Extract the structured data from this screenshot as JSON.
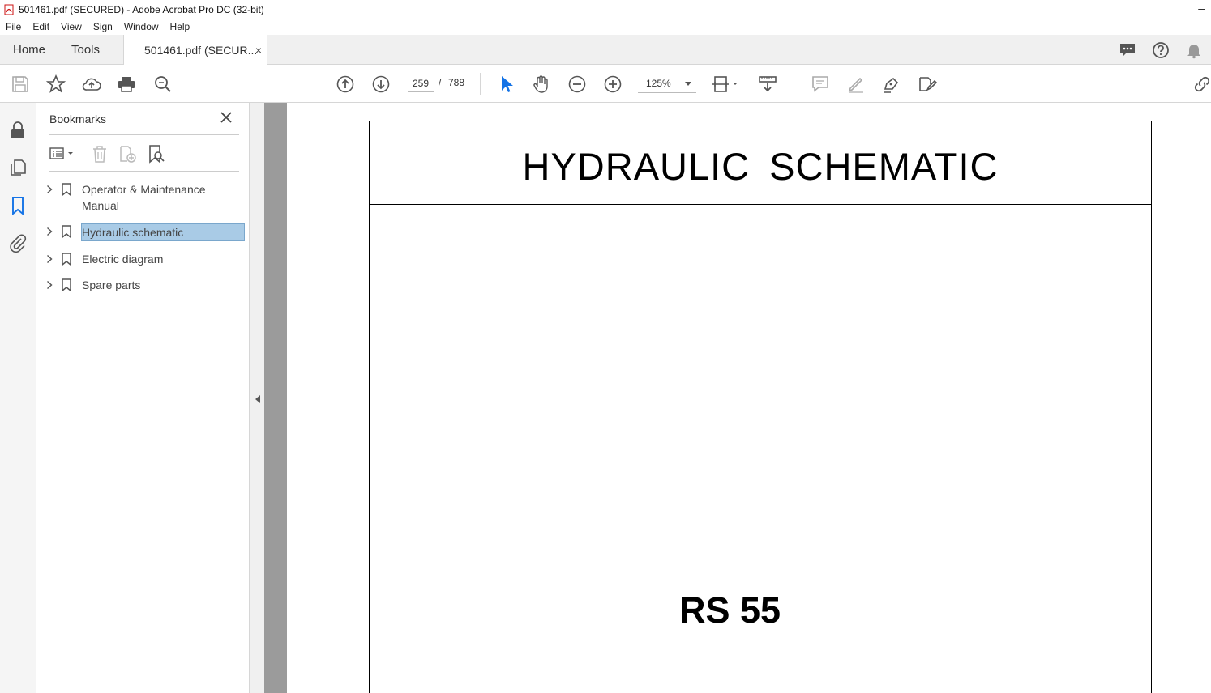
{
  "window": {
    "title": "501461.pdf (SECURED) - Adobe Acrobat Pro DC (32-bit)",
    "minimize_glyph": "–"
  },
  "menu": [
    "File",
    "Edit",
    "View",
    "Sign",
    "Window",
    "Help"
  ],
  "tabs": {
    "home": "Home",
    "tools": "Tools",
    "document": "501461.pdf (SECUR...",
    "close_glyph": "×"
  },
  "toolbar": {
    "page_current": "259",
    "page_sep": "/",
    "page_total": "788",
    "zoom": "125%"
  },
  "panel": {
    "title": "Bookmarks",
    "bookmarks": [
      {
        "label": "Operator & Maintenance Manual",
        "selected": false
      },
      {
        "label": "Hydraulic schematic",
        "selected": true
      },
      {
        "label": "Electric diagram",
        "selected": false
      },
      {
        "label": "Spare parts",
        "selected": false
      }
    ]
  },
  "document": {
    "title": "HYDRAULIC  SCHEMATIC",
    "model": "RS 55"
  },
  "colors": {
    "selection": "#a9cbe6",
    "accent": "#1473e6",
    "canvas": "#9b9b9b"
  }
}
